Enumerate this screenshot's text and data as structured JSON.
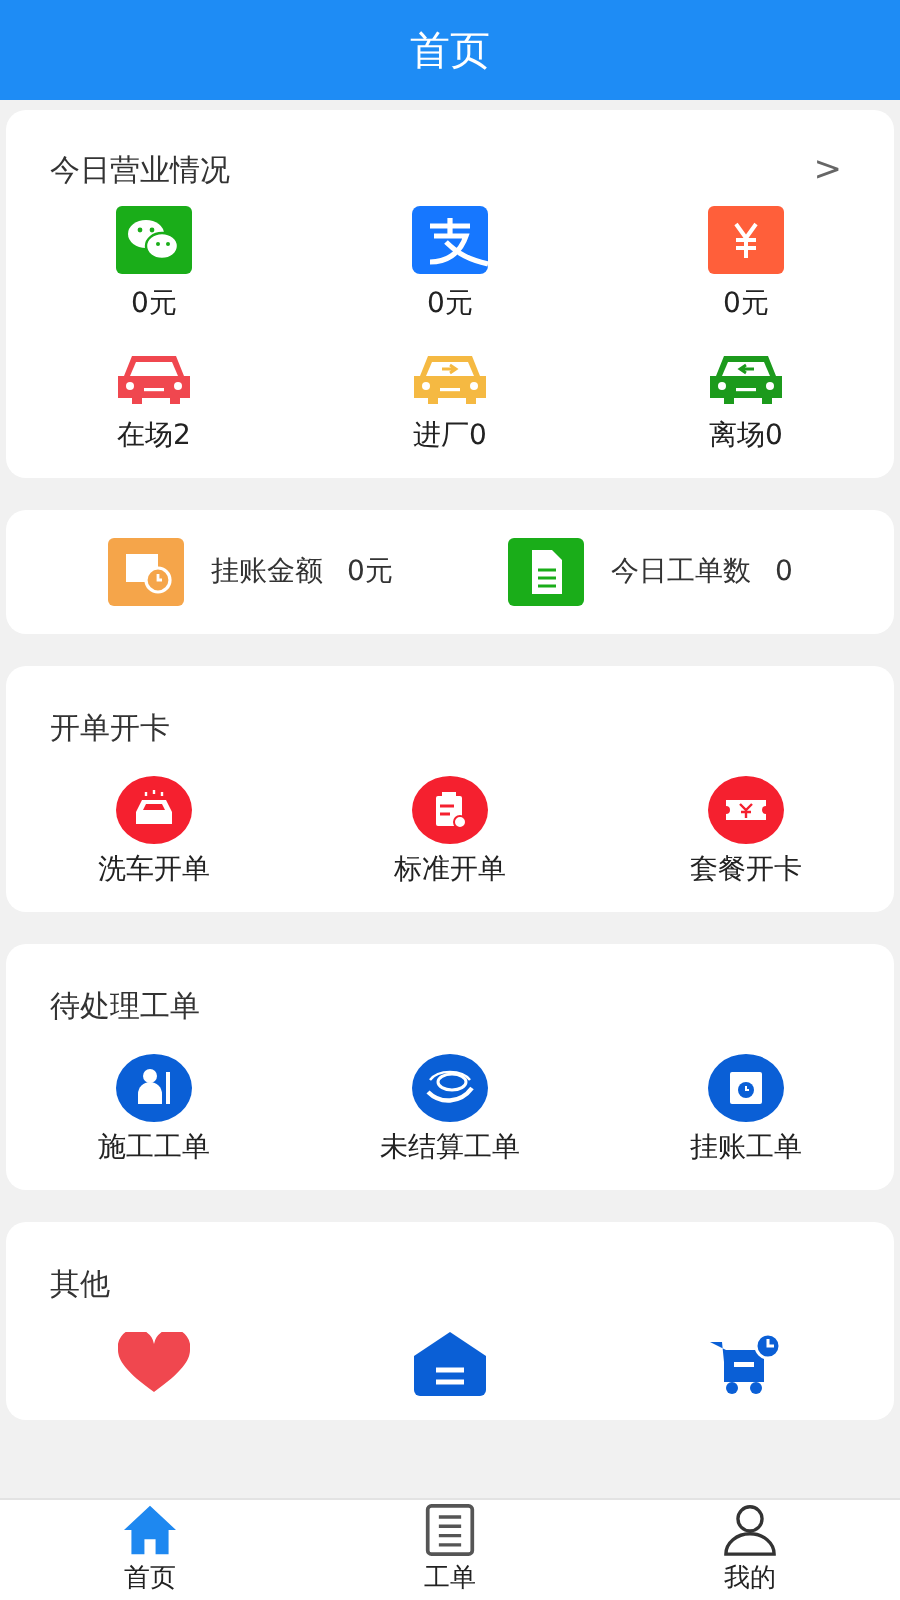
{
  "header": {
    "title": "首页"
  },
  "business": {
    "title": "今日营业情况",
    "chevron": ">",
    "payments": [
      {
        "kind": "wechat",
        "amount": "0元"
      },
      {
        "kind": "alipay",
        "amount": "0元"
      },
      {
        "kind": "cash",
        "amount": "0元"
      }
    ],
    "cars": [
      {
        "kind": "present",
        "color": "#f0474f",
        "label": "在场2"
      },
      {
        "kind": "in",
        "color": "#f5b942",
        "label": "进厂0"
      },
      {
        "kind": "out",
        "color": "#1c9a1c",
        "label": "离场0"
      }
    ]
  },
  "summary": [
    {
      "kind": "ledger",
      "label": "挂账金额",
      "value": "0元"
    },
    {
      "kind": "orders",
      "label": "今日工单数",
      "value": "0"
    }
  ],
  "sections": [
    {
      "title": "开单开卡",
      "items": [
        {
          "kind": "wash",
          "label": "洗车开单"
        },
        {
          "kind": "standard",
          "label": "标准开单"
        },
        {
          "kind": "package",
          "label": "套餐开卡"
        }
      ]
    },
    {
      "title": "待处理工单",
      "items": [
        {
          "kind": "work",
          "label": "施工工单"
        },
        {
          "kind": "unsettled",
          "label": "未结算工单"
        },
        {
          "kind": "credit",
          "label": "挂账工单"
        }
      ]
    },
    {
      "title": "其他",
      "items": [
        {
          "kind": "heart"
        },
        {
          "kind": "warehouse"
        },
        {
          "kind": "cart"
        }
      ]
    }
  ],
  "tabs": [
    {
      "kind": "home",
      "label": "首页",
      "selected": true
    },
    {
      "kind": "orders",
      "label": "工单",
      "selected": false
    },
    {
      "kind": "me",
      "label": "我的",
      "selected": false
    }
  ]
}
